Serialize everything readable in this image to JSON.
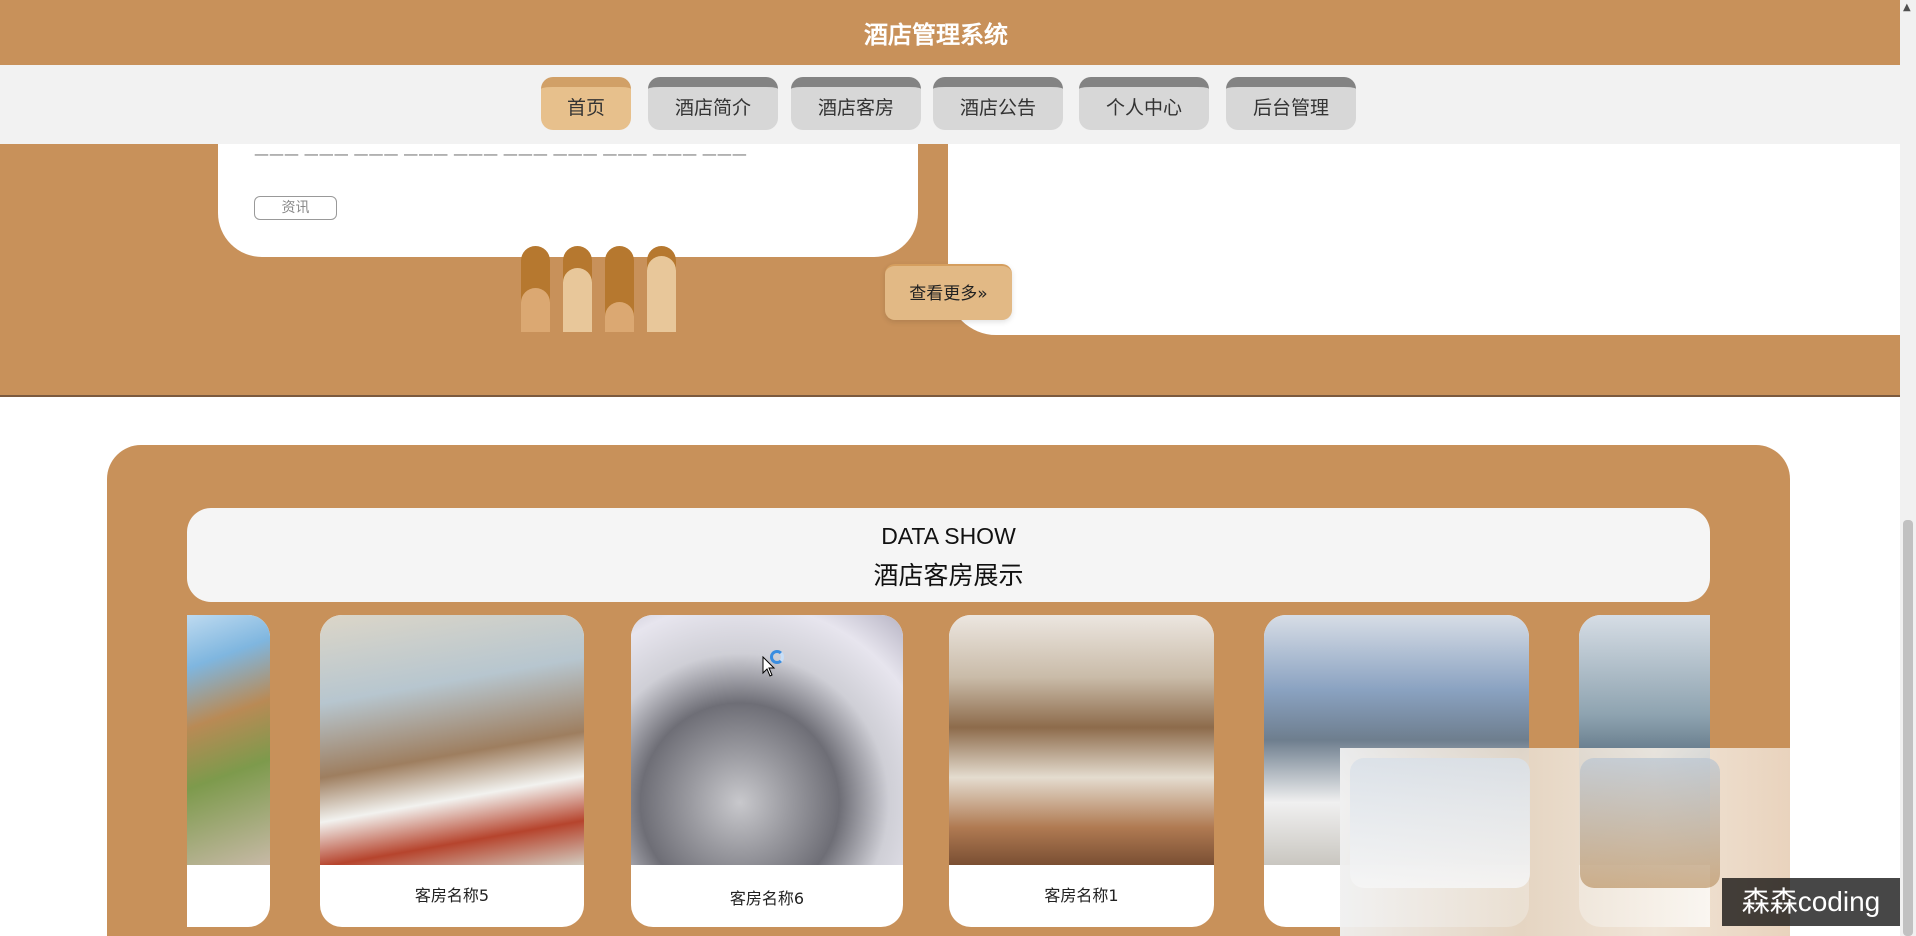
{
  "app": {
    "title": "酒店管理系统"
  },
  "nav": {
    "items": [
      {
        "label": "首页",
        "active": true
      },
      {
        "label": "酒店简介",
        "active": false
      },
      {
        "label": "酒店客房",
        "active": false
      },
      {
        "label": "酒店公告",
        "active": false
      },
      {
        "label": "个人中心",
        "active": false
      },
      {
        "label": "后台管理",
        "active": false
      }
    ]
  },
  "news": {
    "tag": "资讯",
    "more": "查看更多»"
  },
  "showcase": {
    "title_en": "DATA SHOW",
    "title_cn": "酒店客房展示",
    "rooms": [
      {
        "name": ""
      },
      {
        "name": "客房名称5"
      },
      {
        "name": "客房名称6"
      },
      {
        "name": "客房名称1"
      },
      {
        "name": ""
      },
      {
        "name": ""
      }
    ]
  },
  "watermark": "森森coding",
  "colors": {
    "brand": "#c8915a",
    "nav_active": "#e7c08c",
    "nav_inactive": "#d7d7d7"
  },
  "icons": {
    "cursor": "mouse-pointer-icon",
    "loading": "loading-spinner-icon",
    "scroll_up": "scroll-up-arrow-icon"
  }
}
